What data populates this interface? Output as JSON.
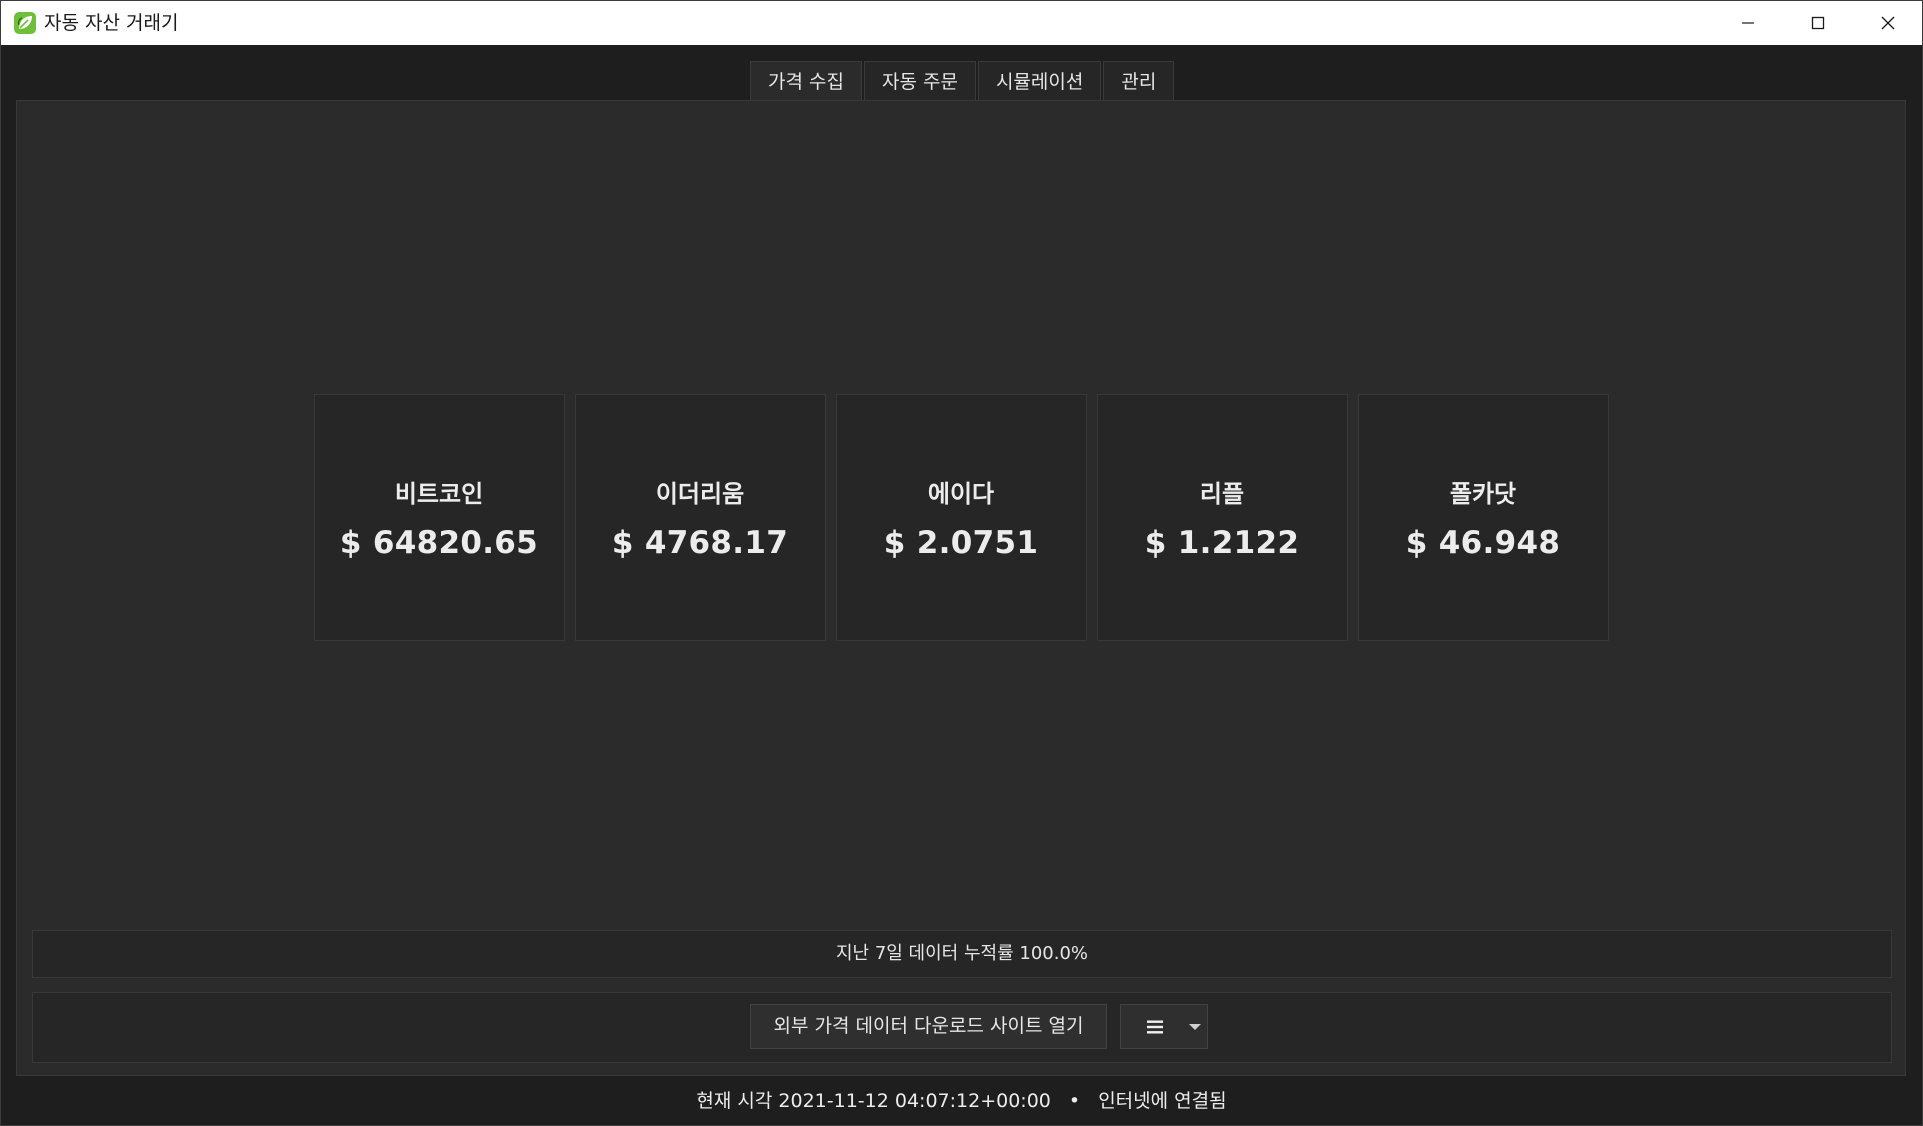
{
  "window": {
    "title": "자동 자산 거래기"
  },
  "tabs": [
    {
      "label": "가격 수집",
      "active": true
    },
    {
      "label": "자동 주문",
      "active": false
    },
    {
      "label": "시뮬레이션",
      "active": false
    },
    {
      "label": "관리",
      "active": false
    }
  ],
  "cards": [
    {
      "name": "비트코인",
      "price": "$ 64820.65"
    },
    {
      "name": "이더리움",
      "price": "$ 4768.17"
    },
    {
      "name": "에이다",
      "price": "$ 2.0751"
    },
    {
      "name": "리플",
      "price": "$ 1.2122"
    },
    {
      "name": "폴카닷",
      "price": "$ 46.948"
    }
  ],
  "status": {
    "accumulation_text": "지난 7일 데이터 누적률 100.0%"
  },
  "actions": {
    "open_site_label": "외부 가격 데이터 다운로드 사이트 열기",
    "menu_icon": "hamburger-icon",
    "dropdown_icon": "caret-down-icon"
  },
  "footer": {
    "time_label": "현재 시각 2021-11-12 04:07:12+00:00",
    "separator": "•",
    "connection": "인터넷에 연결됨"
  },
  "colors": {
    "background": "#1e1e1e",
    "panel": "#2b2b2b",
    "card": "#262626",
    "border": "#383838",
    "text": "#ececec",
    "titlebar": "#ffffff",
    "icon_green": "#6fbf3a"
  }
}
